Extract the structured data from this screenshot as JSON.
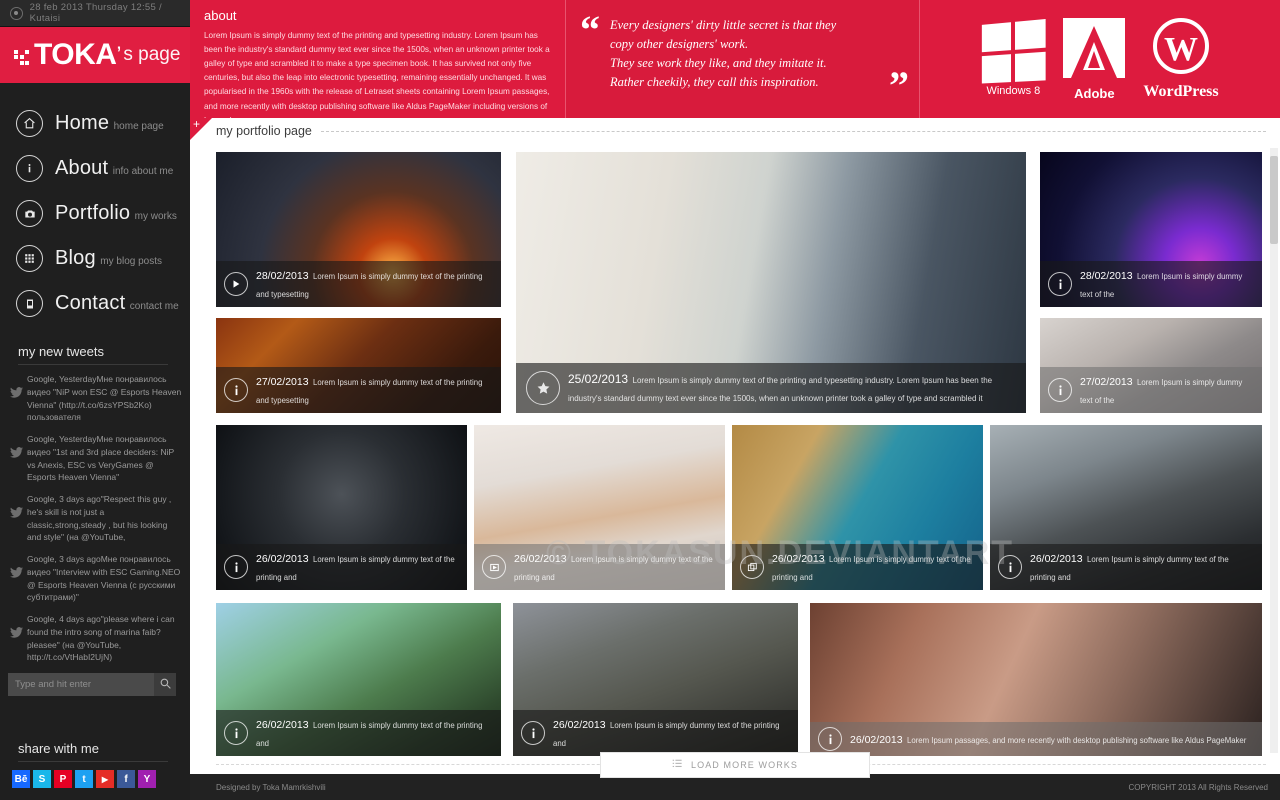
{
  "topbar": {
    "datetime": "28 feb 2013 Thursday  12:55  /  Kutaisi"
  },
  "brand": {
    "name": "TOKA",
    "apostrophe": "’",
    "suffix": "s page"
  },
  "nav": {
    "items": [
      {
        "label": "Home",
        "sub": "home page",
        "icon": "home-icon"
      },
      {
        "label": "About",
        "sub": "info about me",
        "icon": "info-icon"
      },
      {
        "label": "Portfolio",
        "sub": "my works",
        "icon": "camera-icon"
      },
      {
        "label": "Blog",
        "sub": "my blog posts",
        "icon": "grid-icon"
      },
      {
        "label": "Contact",
        "sub": "contact me",
        "icon": "phone-icon"
      }
    ]
  },
  "tweets": {
    "heading": "my new tweets",
    "items": [
      "Google, YesterdayМне понравилось видео \"NiP won ESC @ Esports Heaven Vienna\" (http://t.co/6zsYPSb2Ko) пользователя",
      "Google, YesterdayМне понравилось видео \"1st and 3rd place deciders: NiP vs Anexis, ESC vs VeryGames @ Esports Heaven Vienna\"",
      "Google, 3 days ago\"Respect this guy , he's skill is not just a classic,strong,steady , but his looking and style\" (на @YouTube,",
      "Google, 3 days agoМне понравилось видео \"Interview with ESC Gaming.NEO @ Esports Heaven Vienna (с русскими субтитрами)\"",
      "Google, 4 days ago\"please where i can found the intro song of marina faib? pleasee\" (на @YouTube, http://t.co/VtHabI2UjN)"
    ]
  },
  "search": {
    "placeholder": "Type and hit enter",
    "value": "",
    "icon": "search-icon"
  },
  "share": {
    "heading": "share with me",
    "items": [
      {
        "name": "behance",
        "glyph": "Bē",
        "color": "#1769ff"
      },
      {
        "name": "skype",
        "glyph": "S",
        "color": "#1ab7ea"
      },
      {
        "name": "pinterest",
        "glyph": "P",
        "color": "#e60023"
      },
      {
        "name": "twitter",
        "glyph": "t",
        "color": "#1da1f2"
      },
      {
        "name": "youtube",
        "glyph": "▶",
        "color": "#e52d27"
      },
      {
        "name": "facebook",
        "glyph": "f",
        "color": "#3b5998"
      },
      {
        "name": "yahoo",
        "glyph": "Y",
        "color": "#a020b0"
      }
    ]
  },
  "about": {
    "heading": "about",
    "body": "Lorem Ipsum is simply dummy text of the printing and typesetting industry. Lorem Ipsum has been the industry's standard dummy text ever since the 1500s, when an unknown printer took a galley of type and scrambled it to make a type specimen book. It has survived not only five centuries, but also the leap into electronic typesetting, remaining essentially unchanged. It was popularised in the 1960s with the release of Letraset sheets containing Lorem Ipsum passages, and more recently with desktop publishing software like Aldus PageMaker including versions of Lorem Ipsum."
  },
  "quote": {
    "open_mark": "“",
    "close_mark": "”",
    "line1": "Every designers' dirty little secret is that they",
    "line2": "copy other designers' work.",
    "line3": "They see work they like, and they imitate it.",
    "line4": "Rather cheekily, they call this inspiration."
  },
  "logos": [
    {
      "name": "windows-logo",
      "caption": "Windows 8"
    },
    {
      "name": "adobe-logo",
      "caption": "Adobe"
    },
    {
      "name": "wordpress-logo",
      "caption": "WordPress"
    }
  ],
  "portfolio": {
    "heading": "my portfolio page",
    "load_more": "LOAD MORE WORKS",
    "load_more_icon": "list-icon",
    "watermark": "© TOKASUN.DEVIANTART",
    "items": [
      {
        "date": "28/02/2013",
        "text": "Lorem Ipsum is simply dummy text of the printing and typesetting",
        "icon": "play-icon"
      },
      {
        "date": "27/02/2013",
        "text": "Lorem Ipsum is simply dummy text of the printing and typesetting",
        "icon": "info-icon"
      },
      {
        "date": "25/02/2013",
        "text": "Lorem Ipsum is simply dummy text of the printing and typesetting industry. Lorem Ipsum has been the industry's standard dummy text ever since the 1500s, when an unknown printer took a galley of type and scrambled it",
        "icon": "star-icon"
      },
      {
        "date": "28/02/2013",
        "text": "Lorem Ipsum is simply dummy text of the",
        "icon": "info-icon"
      },
      {
        "date": "27/02/2013",
        "text": "Lorem Ipsum is simply dummy text of the",
        "icon": "info-icon"
      },
      {
        "date": "26/02/2013",
        "text": "Lorem Ipsum is simply dummy text of the printing and",
        "icon": "info-icon"
      },
      {
        "date": "26/02/2013",
        "text": "Lorem Ipsum is simply dummy text of the printing and",
        "icon": "video-icon"
      },
      {
        "date": "26/02/2013",
        "text": "Lorem Ipsum is simply dummy text of the printing and",
        "icon": "gallery-icon"
      },
      {
        "date": "26/02/2013",
        "text": "Lorem Ipsum is simply dummy text of the printing and",
        "icon": "info-icon"
      },
      {
        "date": "26/02/2013",
        "text": "Lorem Ipsum is simply dummy text of the printing and",
        "icon": "info-icon"
      },
      {
        "date": "26/02/2013",
        "text": "Lorem Ipsum is simply dummy text of the printing and",
        "icon": "info-icon"
      },
      {
        "date": "26/02/2013",
        "text": "Lorem Ipsum passages, and more recently with desktop publishing software like Aldus PageMaker",
        "icon": "info-icon"
      }
    ]
  },
  "footer": {
    "left": "Designed by Toka Mamrkishvili",
    "right": "COPYRIGHT 2013  All Rights Reserved"
  },
  "colors": {
    "accent": "#dd1b3e",
    "sidebar": "#1f1f1f",
    "footer": "#222222"
  }
}
